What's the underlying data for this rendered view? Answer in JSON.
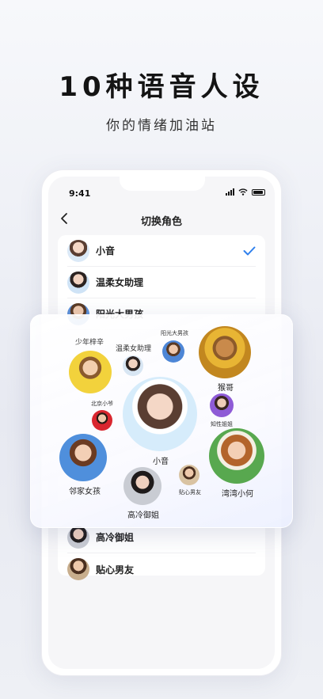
{
  "promo": {
    "headline": "10种语音人设",
    "subline": "你的情绪加油站"
  },
  "status_bar": {
    "time": "9:41"
  },
  "nav": {
    "title": "切换角色"
  },
  "roles": [
    {
      "label": "小音",
      "selected": true
    },
    {
      "label": "温柔女助理",
      "selected": false
    },
    {
      "label": "阳光大男孩",
      "selected": false
    }
  ],
  "roles_bottom": [
    {
      "label": "高冷御姐"
    },
    {
      "label": "贴心男友"
    }
  ],
  "bubbles": {
    "shaonian": "少年梓辛",
    "wenrou": "温柔女助理",
    "yangguang": "阳光大男孩",
    "houge": "猴哥",
    "beijing": "北京小爷",
    "xiaoyin": "小音",
    "zhixing": "知性姐姐",
    "linjia": "邻家女孩",
    "tiexin": "贴心男友",
    "wanwan": "湾湾小何",
    "gaoleng": "高冷御姐"
  },
  "colors": {
    "accent": "#2f80ed",
    "headline": "#141414"
  }
}
